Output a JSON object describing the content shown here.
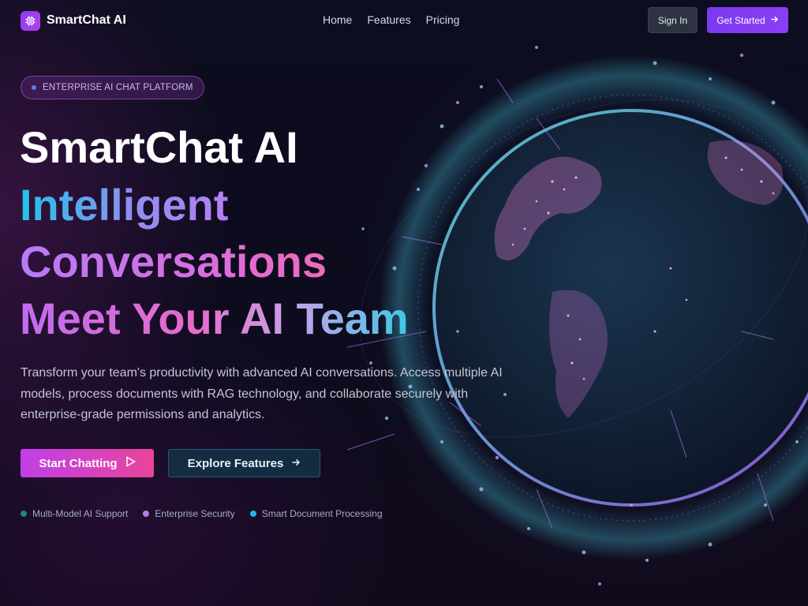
{
  "header": {
    "brand_name": "SmartChat AI",
    "logo_icon": "chip-icon",
    "nav": [
      {
        "label": "Home"
      },
      {
        "label": "Features"
      },
      {
        "label": "Pricing"
      }
    ],
    "sign_in_label": "Sign In",
    "get_started_label": "Get Started",
    "get_started_icon": "arrow-right-icon"
  },
  "hero": {
    "badge_label": "ENTERPRISE AI CHAT PLATFORM",
    "title_line1": "SmartChat AI",
    "title_line2": "Intelligent",
    "title_line3": "Conversations",
    "title_line4": "Meet Your AI Team",
    "description": "Transform your team's productivity with advanced AI conversations. Access multiple AI models, process documents with RAG technology, and collaborate securely with enterprise-grade permissions and analytics.",
    "primary_cta": {
      "label": "Start Chatting",
      "icon": "play-icon"
    },
    "secondary_cta": {
      "label": "Explore Features",
      "icon": "arrow-right-icon"
    },
    "features": [
      {
        "label": "Multi-Model AI Support",
        "color": "#1f8a6a"
      },
      {
        "label": "Enterprise Security",
        "color": "#b77cf0"
      },
      {
        "label": "Smart Document Processing",
        "color": "#1fb6e0"
      }
    ]
  },
  "colors": {
    "background": "#0b0d1c",
    "accent_purple": "#8b3df5",
    "accent_pink": "#e8449a",
    "accent_cyan": "#22c4e8"
  }
}
